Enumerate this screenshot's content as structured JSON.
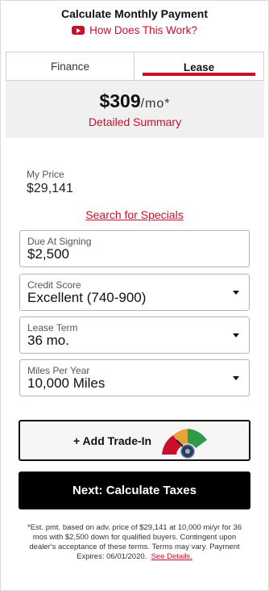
{
  "header": {
    "title": "Calculate Monthly Payment",
    "how_link": "How Does This Work?"
  },
  "tabs": [
    {
      "label": "Finance",
      "active": false
    },
    {
      "label": "Lease",
      "active": true
    }
  ],
  "summary": {
    "price": "$309",
    "per": "/mo*",
    "detailed_link": "Detailed Summary"
  },
  "my_price": {
    "label": "My Price",
    "value": "$29,141"
  },
  "specials_link": "Search for Specials",
  "fields": {
    "due_at_signing": {
      "label": "Due At Signing",
      "value": "$2,500"
    },
    "credit_score": {
      "label": "Credit Score",
      "value": "Excellent (740-900)"
    },
    "lease_term": {
      "label": "Lease Term",
      "value": "36 mo."
    },
    "miles_per_year": {
      "label": "Miles Per Year",
      "value": "10,000 Miles"
    }
  },
  "trade_in": {
    "label": "+ Add Trade-In",
    "icon": "trade-in-gauge-icon",
    "gauge_colors": [
      "#c8102e",
      "#e8a33b",
      "#2e9b48"
    ]
  },
  "next_button": "Next: Calculate Taxes",
  "disclaimer": {
    "text": "*Est. pmt. based on adv. price of $29,141 at 10,000 mi/yr for 36 mos with $2,500 down for qualified buyers. Contingent upon dealer's acceptance of these terms. Terms may vary. Payment Expires: 06/01/2020.",
    "link": "See Details."
  },
  "colors": {
    "accent": "#c8102e",
    "summary_bg": "#f0f0f0",
    "button_bg": "#000000"
  }
}
